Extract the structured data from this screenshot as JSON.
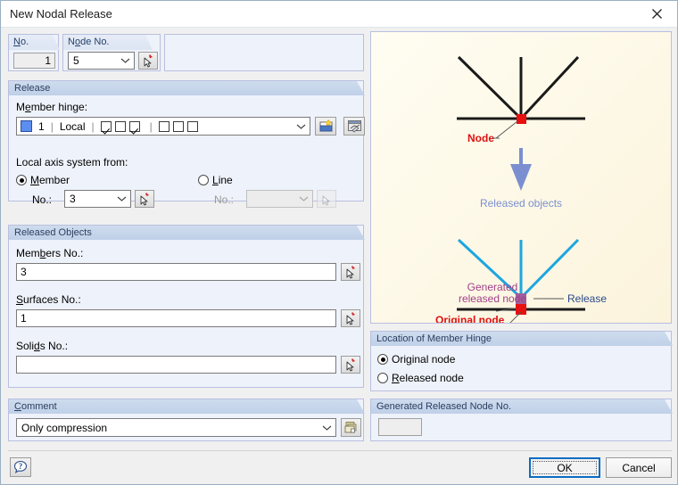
{
  "window": {
    "title": "New Nodal Release",
    "close_icon": "close-icon"
  },
  "identity": {
    "no_label": "No.",
    "no_value": "1",
    "node_no_label": "Node No.",
    "node_no_value": "5",
    "node_pick_icon": "pick-node-icon"
  },
  "release_group": {
    "title": "Release",
    "member_hinge_label": "Member hinge:",
    "hinge": {
      "color": "#5b8ef0",
      "number": "1",
      "system": "Local",
      "group1": [
        true,
        false,
        true
      ],
      "group2": [
        false,
        false,
        false
      ]
    },
    "new_hinge_icon": "new-hinge-icon",
    "edit_hinge_icon": "edit-hinge-icon",
    "local_axis_label": "Local axis system from:",
    "member_radio": "Member",
    "member_selected": true,
    "member_no_label": "No.:",
    "member_no_value": "3",
    "member_pick_icon": "pick-member-icon",
    "line_radio": "Line",
    "line_selected": false,
    "line_no_label": "No.:",
    "line_no_value": "",
    "line_pick_icon": "pick-line-icon"
  },
  "released_objects": {
    "title": "Released Objects",
    "members_label": "Members No.:",
    "members_value": "3",
    "members_pick_icon": "pick-members-icon",
    "surfaces_label": "Surfaces No.:",
    "surfaces_value": "1",
    "surfaces_pick_icon": "pick-surfaces-icon",
    "solids_label": "Solids No.:",
    "solids_value": "",
    "solids_pick_icon": "pick-solids-icon"
  },
  "comment": {
    "title": "Comment",
    "value": "Only compression",
    "library_icon": "comment-library-icon"
  },
  "preview": {
    "node_label": "Node",
    "arrow_label": "Released objects",
    "generated_label_line1": "Generated",
    "generated_label_line2": "released node",
    "release_label": "Release",
    "original_label": "Original node",
    "colors": {
      "member_line": "#1a1a1a",
      "released_line": "#1ea6e0",
      "node_red": "#e81010",
      "generated_node": "#a0609a",
      "arrow_blue": "#7b8fd0",
      "label_red": "#e01010",
      "label_purple": "#a0408a",
      "label_blue": "#2b4a8c"
    }
  },
  "hinge_location": {
    "title": "Location of Member Hinge",
    "original_node": "Original node",
    "released_node": "Released node",
    "selected": "original"
  },
  "generated_node": {
    "title": "Generated Released Node No.",
    "value": ""
  },
  "footer": {
    "help_icon": "help-icon",
    "ok_label": "OK",
    "cancel_label": "Cancel"
  }
}
